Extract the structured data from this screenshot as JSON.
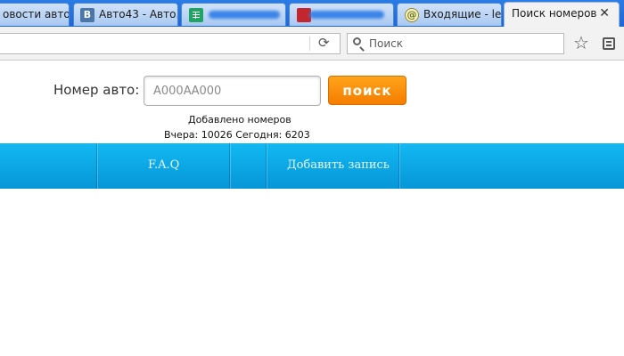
{
  "browser": {
    "tabs": [
      {
        "label": "овости авто ...",
        "icon": "generic"
      },
      {
        "label": "Авто43 - Авто...",
        "icon": "vk-icon",
        "icon_text": "B"
      },
      {
        "label": "",
        "icon": "sheets-icon",
        "obscured": true
      },
      {
        "label": "",
        "icon": "red-icon",
        "obscured": true
      },
      {
        "label": "Входящие - le...",
        "icon": "mail-icon",
        "icon_text": "@"
      },
      {
        "label": "Поиск номеров",
        "active": true
      }
    ],
    "close_glyph": "✕",
    "search_placeholder": "Поиск",
    "reload_glyph": "⟳",
    "star_glyph": "☆"
  },
  "page": {
    "plate_label": "Номер авто:",
    "plate_placeholder": "А000АА000",
    "search_button": "поиск",
    "stats_title": "Добавлено номеров",
    "stats_line": "Вчера: 10026 Сегодня: 6203"
  },
  "nav": {
    "items": [
      "F.A.Q",
      "Добавить запись"
    ]
  },
  "colors": {
    "tabstrip": "#1f66d6",
    "nav_blue": "#0aa5e4",
    "button_orange": "#f7900a"
  }
}
